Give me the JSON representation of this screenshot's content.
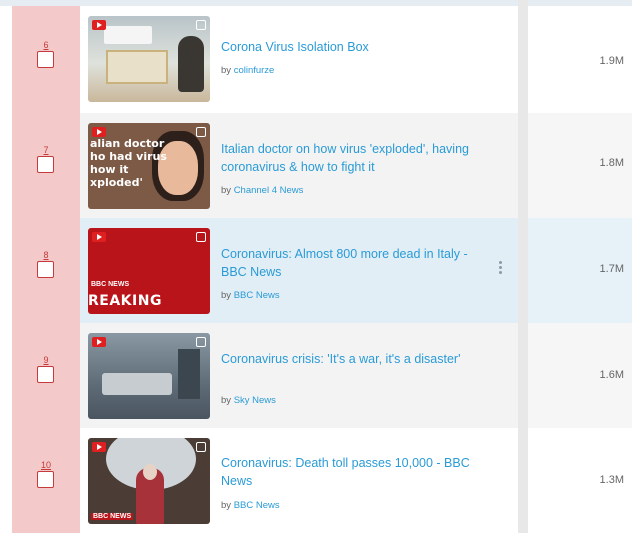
{
  "videos": [
    {
      "rank": "6",
      "title": "Corona Virus Isolation Box",
      "by_label": "by",
      "channel": "colinfurze",
      "views": "1.9M",
      "thumbnail_icons": [
        "youtube-icon",
        "external-link-icon"
      ]
    },
    {
      "rank": "7",
      "title": "Italian doctor on how virus 'exploded', having coronavirus & how to fight it",
      "by_label": "by",
      "channel": "Channel 4 News",
      "views": "1.8M",
      "thumbnail_text": "alian doctor ho had virus how it xploded'",
      "thumbnail_icons": [
        "youtube-icon",
        "external-link-icon"
      ]
    },
    {
      "rank": "8",
      "title": "Coronavirus: Almost 800 more dead in Italy - BBC News",
      "by_label": "by",
      "channel": "BBC News",
      "views": "1.7M",
      "thumbnail_logo": "BBC NEWS",
      "thumbnail_text": "REAKING",
      "thumbnail_icons": [
        "youtube-icon",
        "external-link-icon"
      ],
      "highlighted": true
    },
    {
      "rank": "9",
      "title": "Coronavirus crisis: 'It's a war, it's a disaster'",
      "by_label": "by",
      "channel": "Sky News",
      "views": "1.6M",
      "thumbnail_icons": [
        "youtube-icon",
        "external-link-icon"
      ]
    },
    {
      "rank": "10",
      "title": "Coronavirus: Death toll passes 10,000 - BBC News",
      "by_label": "by",
      "channel": "BBC News",
      "views": "1.3M",
      "thumbnail_logo": "BBC NEWS",
      "thumbnail_icons": [
        "youtube-icon",
        "external-link-icon"
      ]
    }
  ],
  "colors": {
    "accent_link": "#2a9bd6",
    "rank_column": "#f3c9c9",
    "rank_text": "#c53a3a",
    "highlight_row": "#e1eef6"
  },
  "icons": {
    "more_options": "more-vertical-icon"
  }
}
